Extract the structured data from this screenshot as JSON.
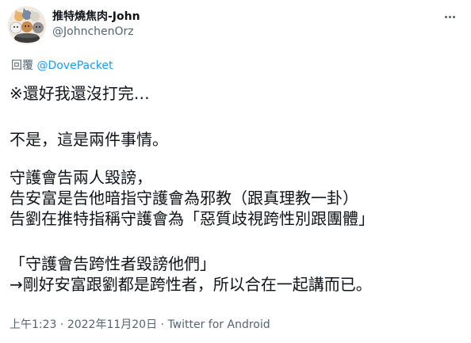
{
  "author": {
    "display_name": "推特燒焦肉-John",
    "handle": "@JohnchenOrz"
  },
  "reply": {
    "prefix": "回覆",
    "mention": "@DovePacket"
  },
  "body": [
    "※還好我還沒打完…",
    "不是，這是兩件事情。",
    "守護會告兩人毀謗，",
    "告安富是告他暗指守護會為邪教（跟真理教一卦）",
    "告劉在推特指稱守護會為「惡質歧視跨性別跟團體」",
    "「守護會告跨性者毀謗他們」",
    "→剛好安富跟劉都是跨性者，所以合在一起講而已。"
  ],
  "meta": {
    "time": "上午1:23",
    "date": "2022年11月20日",
    "source": "Twitter for Android"
  },
  "colors": {
    "text": "#0f1419",
    "secondary": "#536471",
    "link": "#1d9bf0"
  },
  "icons": {
    "more": "more-options-icon",
    "avatar": "cartoon-cats-avatar"
  }
}
